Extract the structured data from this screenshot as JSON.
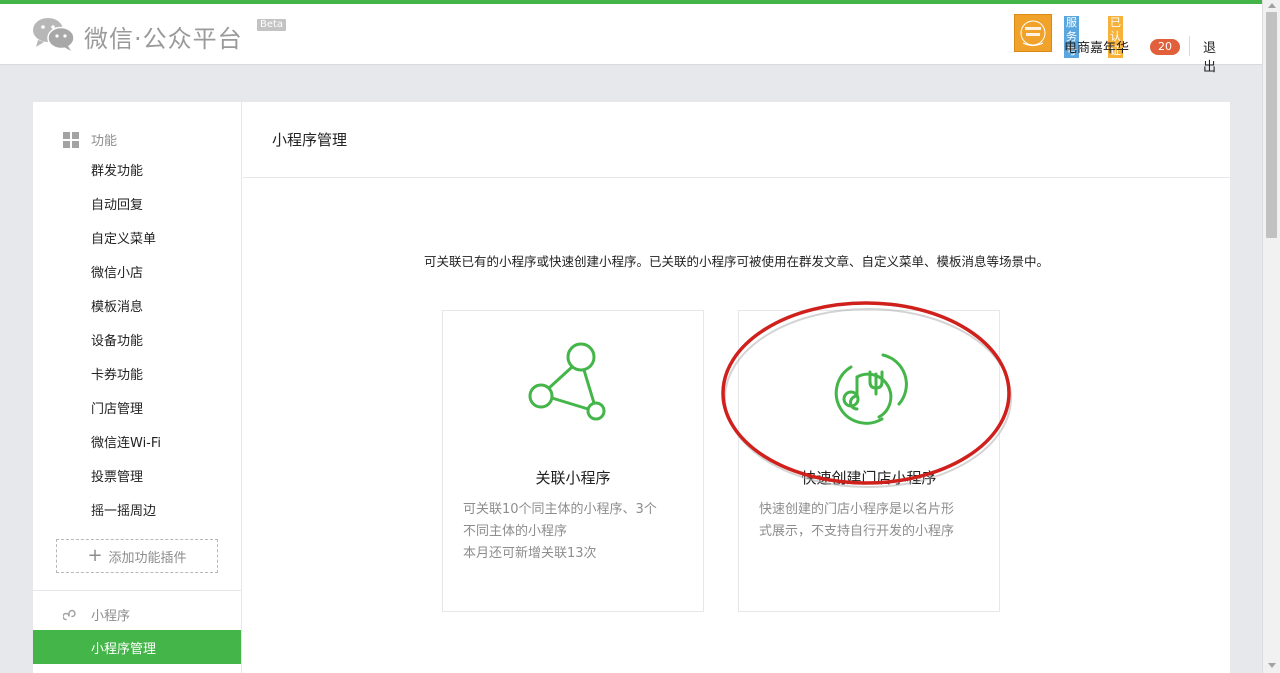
{
  "header": {
    "logo_text": "微信·公众平台",
    "beta_label": "Beta",
    "account": {
      "type_badge": "服务号",
      "cert_badge": "已认证",
      "name": "电商嘉年华",
      "message_count": "20",
      "logout_label": "退出"
    }
  },
  "sidebar": {
    "group_function": {
      "title": "功能",
      "items": [
        "群发功能",
        "自动回复",
        "自定义菜单",
        "微信小店",
        "模板消息",
        "设备功能",
        "卡券功能",
        "门店管理",
        "微信连Wi-Fi",
        "投票管理",
        "摇一摇周边"
      ]
    },
    "add_plugin_label": "添加功能插件",
    "group_miniprogram": {
      "title": "小程序",
      "active_item": "小程序管理"
    }
  },
  "main": {
    "title": "小程序管理",
    "intro": "可关联已有的小程序或快速创建小程序。已关联的小程序可被使用在群发文章、自定义菜单、模板消息等场景中。",
    "cards": [
      {
        "title": "关联小程序",
        "desc_lines": [
          "可关联10个同主体的小程序、3个",
          "不同主体的小程序",
          "本月还可新增关联13次"
        ]
      },
      {
        "title": "快速创建门店小程序",
        "desc_lines": [
          "快速创建的门店小程序是以名片形",
          "式展示，不支持自行开发的小程序"
        ]
      }
    ]
  },
  "colors": {
    "brand_green": "#44b549",
    "annotation_red": "#d0201c",
    "badge_red": "#e15f3a"
  },
  "icons": {
    "logo": "wechat-logo-icon",
    "function_group": "grid-icon",
    "miniprogram_group": "miniprogram-icon",
    "link_card": "link-nodes-icon",
    "store_card": "store-fork-icon"
  }
}
